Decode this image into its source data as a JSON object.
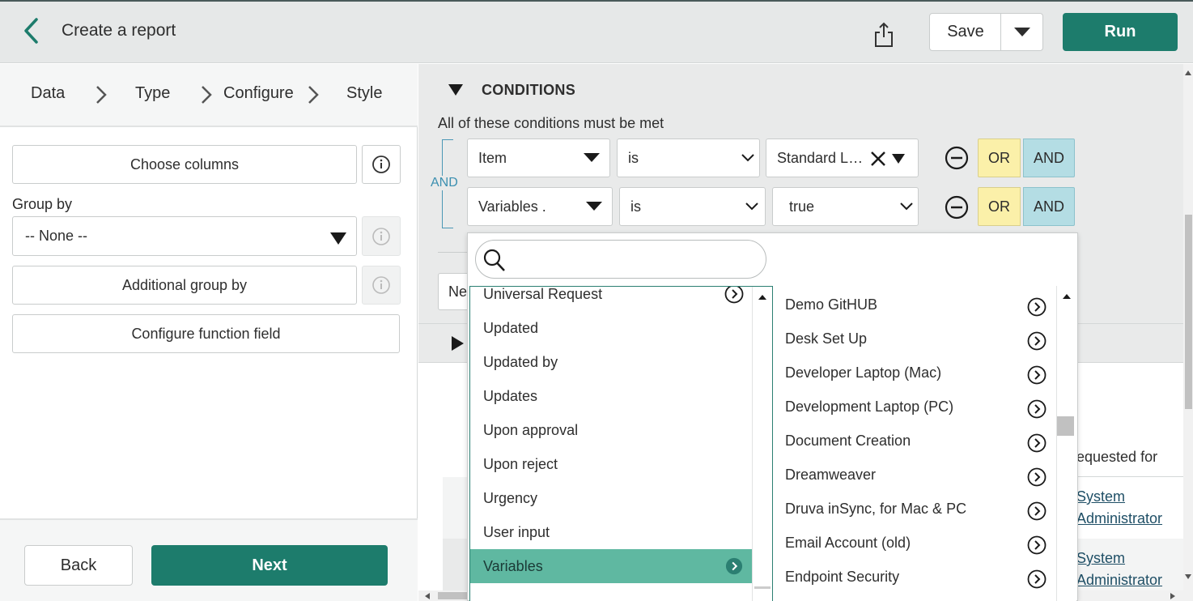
{
  "header": {
    "title": "Create a report",
    "save_label": "Save",
    "run_label": "Run"
  },
  "steps": [
    "Data",
    "Type",
    "Configure",
    "Style"
  ],
  "left": {
    "choose_columns": "Choose columns",
    "group_by_label": "Group by",
    "group_by_value": "-- None --",
    "additional_group_by": "Additional group by",
    "configure_function_field": "Configure function field",
    "back_label": "Back",
    "next_label": "Next"
  },
  "conditions": {
    "title": "CONDITIONS",
    "subtitle": "All of these conditions must be met",
    "and_label": "AND",
    "rows": [
      {
        "field": "Item",
        "operator": "is",
        "value": "Standard L…",
        "or": "OR",
        "and": "AND"
      },
      {
        "field": "Variables .",
        "operator": "is",
        "value": "true",
        "or": "OR",
        "and": "AND"
      }
    ],
    "new_button_partial": "Ne"
  },
  "table": {
    "column_header_partial": "equested for",
    "rows": [
      {
        "line1": "System",
        "line2": "Administrator"
      },
      {
        "line1": "System",
        "line2": "Administrator"
      }
    ]
  },
  "popup": {
    "search_placeholder": "",
    "left_items": [
      {
        "label": "Universal Request",
        "arrow": true
      },
      {
        "label": "Updated",
        "arrow": false
      },
      {
        "label": "Updated by",
        "arrow": false
      },
      {
        "label": "Updates",
        "arrow": false
      },
      {
        "label": "Upon approval",
        "arrow": false
      },
      {
        "label": "Upon reject",
        "arrow": false
      },
      {
        "label": "Urgency",
        "arrow": false
      },
      {
        "label": "User input",
        "arrow": false
      },
      {
        "label": "Variables",
        "arrow": true,
        "selected": true
      }
    ],
    "right_items": [
      "Demo GitHUB",
      "Desk Set Up",
      "Developer Laptop (Mac)",
      "Development Laptop (PC)",
      "Document Creation",
      "Dreamweaver",
      "Druva inSync, for Mac & PC",
      "Email Account (old)",
      "Endpoint Security"
    ]
  },
  "colors": {
    "primary": "#1d7c6c",
    "selected_item": "#5fb8a1",
    "or_button": "#fbf0a9",
    "and_button": "#b4dde4",
    "and_label": "#3b8fb0"
  }
}
